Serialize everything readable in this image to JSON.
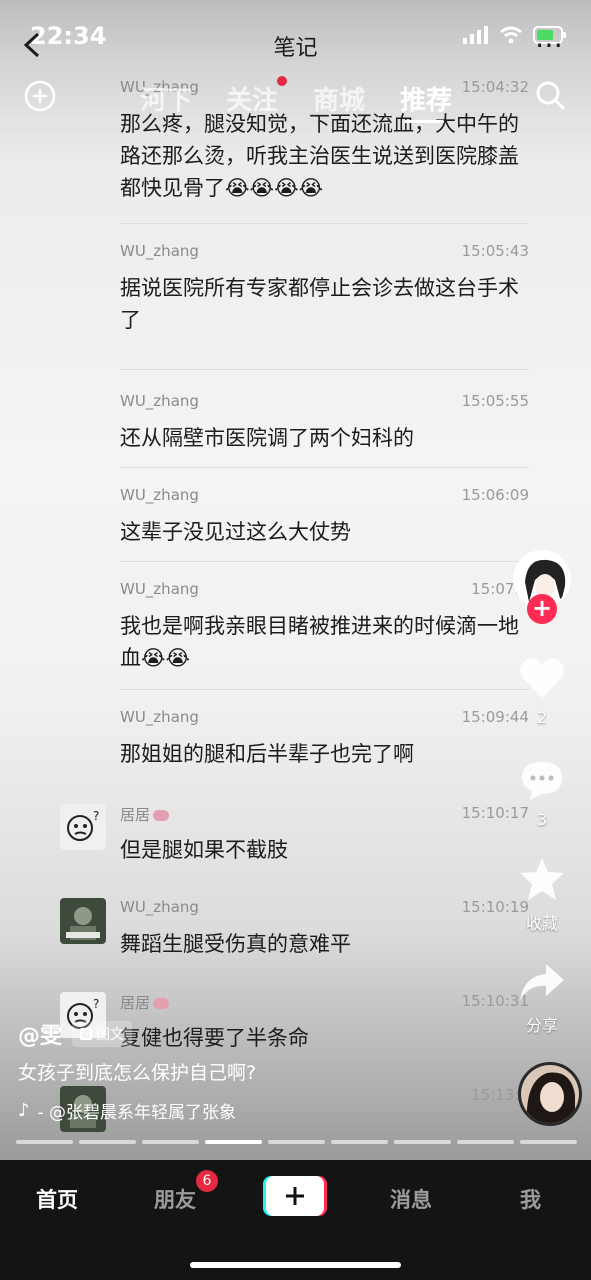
{
  "status_bar": {
    "time": "22:34"
  },
  "header": {
    "title": "笔记"
  },
  "top_tabs": [
    {
      "label": "河下"
    },
    {
      "label": "关注"
    },
    {
      "label": "商城"
    },
    {
      "label": "推荐"
    }
  ],
  "messages": [
    {
      "sender": "WU_zhang",
      "time": "15:04:32",
      "text": "那么疼，腿没知觉，下面还流血，大中午的路还那么烫，听我主治医生说送到医院膝盖都快见骨了😭😭😭😭"
    },
    {
      "sender": "WU_zhang",
      "time": "15:05:43",
      "text": "据说医院所有专家都停止会诊去做这台手术了"
    },
    {
      "sender": "WU_zhang",
      "time": "15:05:55",
      "text": "还从隔壁市医院调了两个妇科的"
    },
    {
      "sender": "WU_zhang",
      "time": "15:06:09",
      "text": "这辈子没见过这么大仗势"
    },
    {
      "sender": "WU_zhang",
      "time": "15:07:3",
      "text": "我也是啊我亲眼目睹被推进来的时候滴一地血😭😭"
    },
    {
      "sender": "WU_zhang",
      "time": "15:09:44",
      "text": "那姐姐的腿和后半辈子也完了啊"
    },
    {
      "sender": "居居",
      "time": "15:10:17",
      "text": "但是腿如果不截肢"
    },
    {
      "sender": "WU_zhang",
      "time": "15:10:19",
      "text": "舞蹈生腿受伤真的意难平"
    },
    {
      "sender": "居居",
      "time": "15:10:31",
      "text": "复健也得要了半条命"
    },
    {
      "sender": "",
      "time": "15:13:3",
      "text": ""
    }
  ],
  "actions": {
    "like_count": "2",
    "comment_count": "3",
    "favorite_label": "收藏",
    "share_label": "分享"
  },
  "post": {
    "author": "@雯",
    "tag": "图文",
    "caption": "女孩子到底怎么保护自己啊?",
    "music": "- @张碧晨系年轻属了张象"
  },
  "progress": {
    "segments": 9,
    "current_index": 3
  },
  "bottom_nav": {
    "home": "首页",
    "friends": "朋友",
    "friends_badge": "6",
    "messages": "消息",
    "me": "我"
  }
}
